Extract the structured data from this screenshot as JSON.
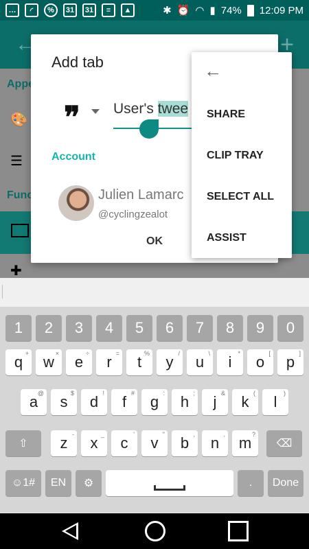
{
  "status_bar": {
    "battery": "74%",
    "time": "12:09 PM",
    "calendar_day_1": "31",
    "calendar_day_2": "31"
  },
  "background": {
    "section_1_partial": "Appe",
    "section_2_partial": "Func"
  },
  "dialog": {
    "title": "Add tab",
    "tab_name_before": "User's ",
    "tab_name_selected": "twee",
    "account_label": "Account",
    "account_name": "Julien Lamarc",
    "account_handle": "@cyclingzealot",
    "ok_label": "OK"
  },
  "context_menu": {
    "items": [
      "SHARE",
      "CLIP TRAY",
      "SELECT ALL",
      "ASSIST"
    ]
  },
  "keyboard": {
    "number_row": [
      "1",
      "2",
      "3",
      "4",
      "5",
      "6",
      "7",
      "8",
      "9",
      "0"
    ],
    "row1": [
      {
        "k": "q",
        "s": "+"
      },
      {
        "k": "w",
        "s": "×"
      },
      {
        "k": "e",
        "s": "÷"
      },
      {
        "k": "r",
        "s": "="
      },
      {
        "k": "t",
        "s": "%"
      },
      {
        "k": "y",
        "s": "/"
      },
      {
        "k": "u",
        "s": "\\"
      },
      {
        "k": "i",
        "s": "*"
      },
      {
        "k": "o",
        "s": "["
      },
      {
        "k": "p",
        "s": "]"
      }
    ],
    "row2": [
      {
        "k": "a",
        "s": "@"
      },
      {
        "k": "s",
        "s": "$"
      },
      {
        "k": "d",
        "s": "!"
      },
      {
        "k": "f",
        "s": "#"
      },
      {
        "k": "g",
        "s": ":"
      },
      {
        "k": "h",
        "s": ";"
      },
      {
        "k": "j",
        "s": "&"
      },
      {
        "k": "k",
        "s": "("
      },
      {
        "k": "l",
        "s": ")"
      }
    ],
    "row3": [
      {
        "k": "z",
        "s": "-"
      },
      {
        "k": "x",
        "s": "_"
      },
      {
        "k": "c",
        "s": "'"
      },
      {
        "k": "v",
        "s": "\""
      },
      {
        "k": "b",
        "s": ","
      },
      {
        "k": "n",
        "s": "."
      },
      {
        "k": "m",
        "s": "?"
      }
    ],
    "emoji_label": "☺1#",
    "lang_label": "EN",
    "period_label": ".",
    "done_label": "Done"
  }
}
